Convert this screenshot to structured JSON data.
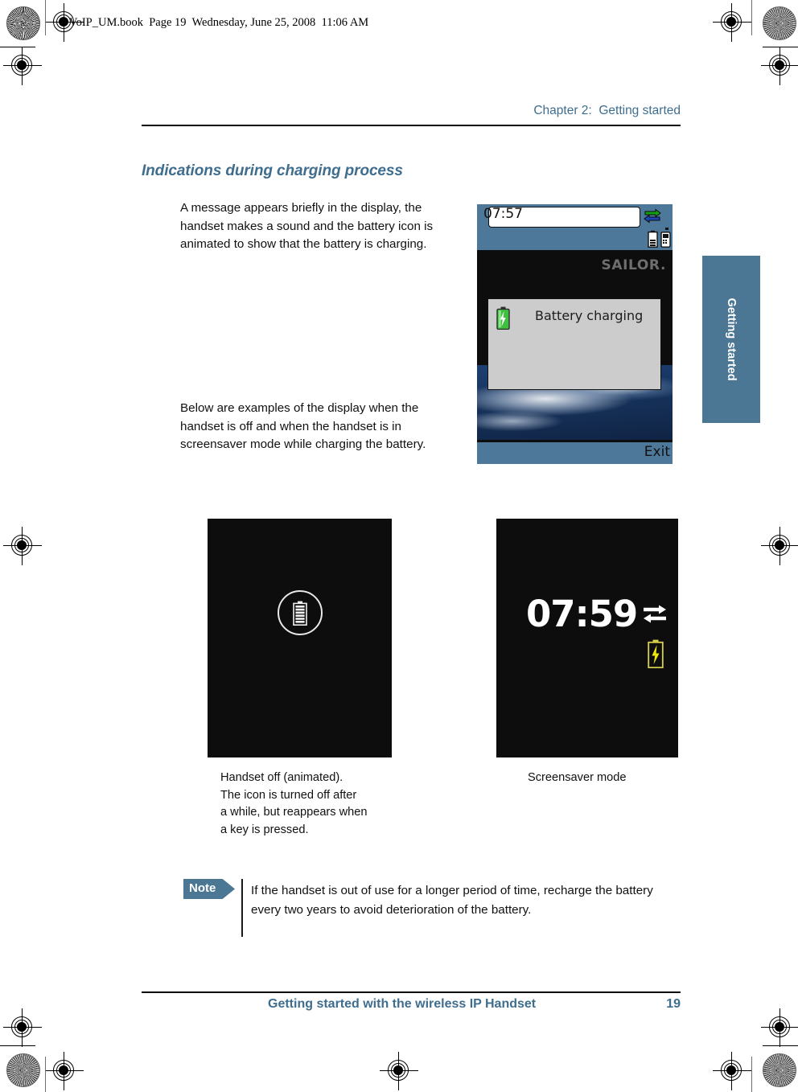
{
  "print_marks": {
    "book_slug": "VoIP_UM.book  Page 19  Wednesday, June 25, 2008  11:06 AM"
  },
  "header": {
    "chapter": "Chapter 2:  Getting started"
  },
  "section": {
    "title": "Indications during charging process"
  },
  "body": {
    "paragraph_1": "A message appears briefly in the display, the handset makes a sound and the battery icon is animated to show that the battery is charging.",
    "paragraph_2": "Below are examples of the display when the handset is off and when the handset is in screensaver mode while charging the battery."
  },
  "side_tab": {
    "label": "Getting started",
    "color": "#4b7694"
  },
  "phone_screenshot": {
    "status_time": "07:57",
    "brand_logo": "SAILOR.",
    "dialog_text": "Battery charging",
    "softkey_label": "Exit",
    "statusbar_color": "#4e789a",
    "dialog_bg": "#cccccc",
    "icons": {
      "network_arrows": "network-arrows-icon",
      "signal": "signal-bars-icon",
      "battery": "battery-icon",
      "handset": "handset-icon",
      "dialog_battery": "battery-charging-icon"
    }
  },
  "displays": {
    "handset_off": {
      "caption": "Handset off (animated).\nThe icon is turned off after\na while, but reappears when\na key is pressed.",
      "icon": "battery-in-circle-icon",
      "background": "#0d0d0d"
    },
    "screensaver": {
      "caption": "Screensaver mode",
      "time": "07:59",
      "icons": {
        "network_arrows": "network-arrows-icon",
        "battery_charging": "battery-charging-icon"
      },
      "background": "#0d0d0d"
    }
  },
  "note": {
    "badge": "Note",
    "text": "If the handset is out of use for a longer period of time, recharge the battery every two years to avoid deterioration of the battery."
  },
  "footer": {
    "title": "Getting started with the wireless IP Handset",
    "page_number": "19",
    "color": "#3f6d8e"
  }
}
